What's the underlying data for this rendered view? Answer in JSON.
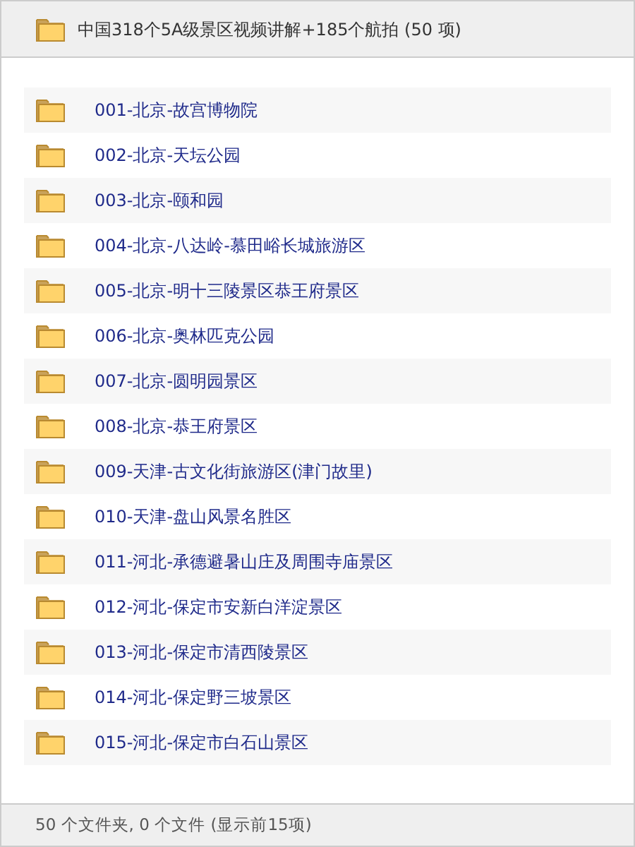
{
  "header": {
    "title": "中国318个5A级景区视频讲解+185个航拍 (50 项)"
  },
  "folders": [
    {
      "name": "001-北京-故宫博物院"
    },
    {
      "name": "002-北京-天坛公园"
    },
    {
      "name": "003-北京-颐和园"
    },
    {
      "name": "004-北京-八达岭-慕田峪长城旅游区"
    },
    {
      "name": "005-北京-明十三陵景区恭王府景区"
    },
    {
      "name": "006-北京-奥林匹克公园"
    },
    {
      "name": "007-北京-圆明园景区"
    },
    {
      "name": "008-北京-恭王府景区"
    },
    {
      "name": "009-天津-古文化街旅游区(津门故里)"
    },
    {
      "name": "010-天津-盘山风景名胜区"
    },
    {
      "name": "011-河北-承德避暑山庄及周围寺庙景区"
    },
    {
      "name": "012-河北-保定市安新白洋淀景区"
    },
    {
      "name": "013-河北-保定市清西陵景区"
    },
    {
      "name": "014-河北-保定野三坡景区"
    },
    {
      "name": "015-河北-保定市白石山景区"
    }
  ],
  "status_bar": {
    "text": "50 个文件夹, 0 个文件 (显示前15项)"
  }
}
